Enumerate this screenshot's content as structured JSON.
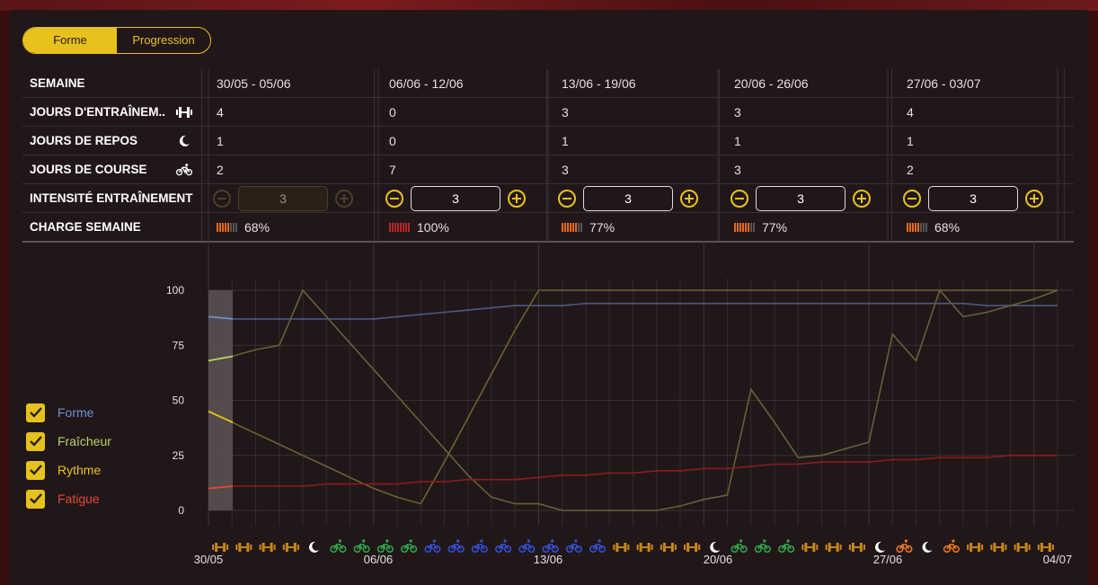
{
  "toggle": {
    "forme": "Forme",
    "progression": "Progression"
  },
  "table": {
    "row_labels": {
      "week": "SEMAINE",
      "training": "JOURS D'ENTRAÎNEM..",
      "rest": "JOURS DE REPOS",
      "race": "JOURS DE COURSE",
      "intensity": "INTENSITÉ ENTRAÎNEMENT",
      "load": "CHARGE SEMAINE"
    },
    "weeks": [
      {
        "range": "30/05 - 05/06",
        "training": "4",
        "rest": "1",
        "race": "2",
        "intensity": "3",
        "load": "68%",
        "load_level": 0.68,
        "load_color": "#e5691d",
        "stepper_enabled": false
      },
      {
        "range": "06/06 - 12/06",
        "training": "0",
        "rest": "0",
        "race": "7",
        "intensity": "3",
        "load": "100%",
        "load_level": 1.0,
        "load_color": "#b3262a",
        "stepper_enabled": true
      },
      {
        "range": "13/06 - 19/06",
        "training": "3",
        "rest": "1",
        "race": "3",
        "intensity": "3",
        "load": "77%",
        "load_level": 0.77,
        "load_color": "#e5691d",
        "stepper_enabled": true
      },
      {
        "range": "20/06 - 26/06",
        "training": "3",
        "rest": "1",
        "race": "3",
        "intensity": "3",
        "load": "77%",
        "load_level": 0.77,
        "load_color": "#e5691d",
        "stepper_enabled": true
      },
      {
        "range": "27/06 - 03/07",
        "training": "4",
        "rest": "1",
        "race": "2",
        "intensity": "3",
        "load": "68%",
        "load_level": 0.68,
        "load_color": "#e5691d",
        "stepper_enabled": true
      }
    ]
  },
  "legend": [
    {
      "label": "Forme",
      "color": "#6b93d6",
      "checked": true
    },
    {
      "label": "Fraîcheur",
      "color": "#b9d36a",
      "checked": true
    },
    {
      "label": "Rythme",
      "color": "#e8c21c",
      "checked": true
    },
    {
      "label": "Fatigue",
      "color": "#e04a3a",
      "checked": true
    }
  ],
  "chart_data": {
    "type": "line",
    "ylim": [
      0,
      100
    ],
    "yticks": [
      "0",
      "25",
      "50",
      "75",
      "100"
    ],
    "xticks": [
      "30/05",
      "06/06",
      "13/06",
      "20/06",
      "27/06",
      "04/07"
    ],
    "day_activities": [
      "training",
      "training",
      "training",
      "training",
      "rest",
      "race",
      "race",
      "race",
      "race",
      "race-blue",
      "race-blue",
      "race-blue",
      "race-blue",
      "race-blue",
      "race-blue",
      "race-blue",
      "race-blue",
      "training",
      "training",
      "training",
      "training",
      "rest",
      "race",
      "race",
      "race",
      "training",
      "training",
      "training",
      "rest",
      "race-orange",
      "rest",
      "race-orange",
      "training",
      "training",
      "training",
      "training"
    ],
    "activity_colors": {
      "training": "#c9871a",
      "rest": "#ffffff",
      "race": "#2fa84a",
      "race-blue": "#3550d4",
      "race-orange": "#ee7a1f"
    },
    "series": [
      {
        "name": "Forme",
        "color": "#4a5a82",
        "values": [
          88,
          87,
          87,
          87,
          87,
          87,
          87,
          87,
          88,
          89,
          90,
          91,
          92,
          93,
          93,
          93,
          94,
          94,
          94,
          94,
          94,
          94,
          94,
          94,
          94,
          94,
          94,
          94,
          94,
          94,
          94,
          94,
          94,
          93,
          93,
          93,
          93
        ]
      },
      {
        "name": "Fraîcheur",
        "color": "#646238",
        "values": [
          68,
          70,
          73,
          75,
          100,
          88,
          76,
          64,
          52,
          40,
          28,
          16,
          6,
          3,
          3,
          0,
          0,
          0,
          0,
          0,
          2,
          5,
          7,
          55,
          40,
          24,
          25,
          28,
          31,
          80,
          68,
          100,
          88,
          90,
          93,
          96,
          100
        ]
      },
      {
        "name": "Rythme",
        "color": "#6f6132",
        "values": [
          45,
          40,
          35,
          30,
          25,
          20,
          15,
          10,
          6,
          3,
          22,
          42,
          62,
          82,
          100,
          100,
          100,
          100,
          100,
          100,
          100,
          100,
          100,
          100,
          100,
          100,
          100,
          100,
          100,
          100,
          100,
          100,
          100,
          100,
          100,
          100,
          100
        ]
      },
      {
        "name": "Fatigue",
        "color": "#8a1d1f",
        "values": [
          10,
          11,
          11,
          11,
          11,
          12,
          12,
          12,
          12,
          13,
          13,
          14,
          14,
          14,
          15,
          16,
          16,
          17,
          17,
          18,
          18,
          19,
          19,
          20,
          21,
          21,
          22,
          22,
          22,
          23,
          23,
          24,
          24,
          24,
          25,
          25,
          25
        ]
      }
    ]
  }
}
